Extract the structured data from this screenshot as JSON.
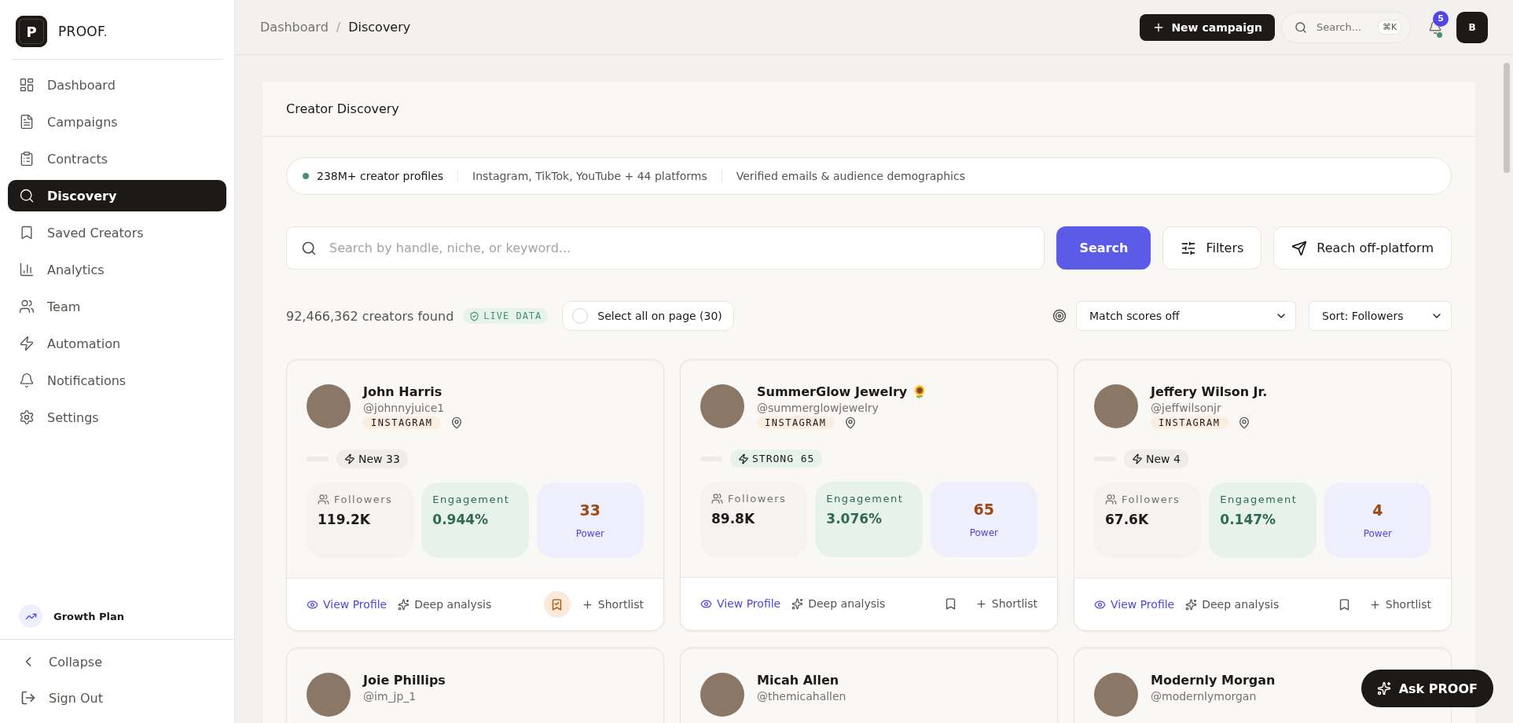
{
  "brand": {
    "logo_letter": "P",
    "name": "PROOF",
    "dot": "."
  },
  "sidebar": {
    "items": [
      {
        "label": "Dashboard",
        "selected": false
      },
      {
        "label": "Campaigns",
        "selected": false
      },
      {
        "label": "Contracts",
        "selected": false
      },
      {
        "label": "Discovery",
        "selected": true
      },
      {
        "label": "Saved Creators",
        "selected": false
      },
      {
        "label": "Analytics",
        "selected": false
      },
      {
        "label": "Team",
        "selected": false
      },
      {
        "label": "Automation",
        "selected": false
      },
      {
        "label": "Notifications",
        "selected": false
      },
      {
        "label": "Settings",
        "selected": false
      }
    ],
    "plan": "Growth Plan",
    "collapse": "Collapse",
    "sign_out": "Sign Out"
  },
  "topbar": {
    "breadcrumb": [
      "Dashboard",
      "Discovery"
    ],
    "breadcrumb_separator": "/",
    "new_campaign": "New campaign",
    "search_placeholder": "Search...",
    "shortcut": "⌘K",
    "notification_count": "5",
    "avatar_letter": "B"
  },
  "panel": {
    "title": "Creator Discovery",
    "stats": [
      "238M+ creator profiles",
      "Instagram, TikTok, YouTube + 44 platforms",
      "Verified emails & audience demographics"
    ],
    "search_placeholder": "Search by handle, niche, or keyword...",
    "search_button": "Search",
    "filters_button": "Filters",
    "reach_button": "Reach off-platform",
    "results_count": "92,466,362 creators found",
    "live_badge": "LIVE DATA",
    "select_all": {
      "label": "Select all on page (30)",
      "checked": false
    },
    "match_select": "Match scores off",
    "sort_select": "Sort: Followers",
    "cards": [
      {
        "name": "John Harris",
        "handle": "@johnnyjuice1",
        "platform": "INSTAGRAM",
        "tag": {
          "kind": "new",
          "label": "New 33"
        },
        "followers_label": "Followers",
        "followers": "119.2K",
        "engagement_label": "Engagement",
        "engagement": "0.944%",
        "power": "33",
        "power_label": "Power",
        "view": "View Profile",
        "deep": "Deep analysis",
        "saved": true,
        "shortlist": "Shortlist"
      },
      {
        "name": "SummerGlow Jewelry 🌻",
        "handle": "@summerglowjewelry",
        "platform": "INSTAGRAM",
        "tag": {
          "kind": "strong",
          "label": "STRONG 65"
        },
        "followers_label": "Followers",
        "followers": "89.8K",
        "engagement_label": "Engagement",
        "engagement": "3.076%",
        "power": "65",
        "power_label": "Power",
        "view": "View Profile",
        "deep": "Deep analysis",
        "saved": false,
        "shortlist": "Shortlist"
      },
      {
        "name": "Jeffery Wilson Jr.",
        "handle": "@jeffwilsonjr",
        "platform": "INSTAGRAM",
        "tag": {
          "kind": "new",
          "label": "New 4"
        },
        "followers_label": "Followers",
        "followers": "67.6K",
        "engagement_label": "Engagement",
        "engagement": "0.147%",
        "power": "4",
        "power_label": "Power",
        "view": "View Profile",
        "deep": "Deep analysis",
        "saved": false,
        "shortlist": "Shortlist"
      },
      {
        "name": "Joie Phillips",
        "handle": "@im_jp_1"
      },
      {
        "name": "Micah Allen",
        "handle": "@themicahallen"
      },
      {
        "name": "Modernly Morgan",
        "handle": "@modernlymorgan"
      }
    ]
  },
  "assistant_button": "Ask PROOF"
}
